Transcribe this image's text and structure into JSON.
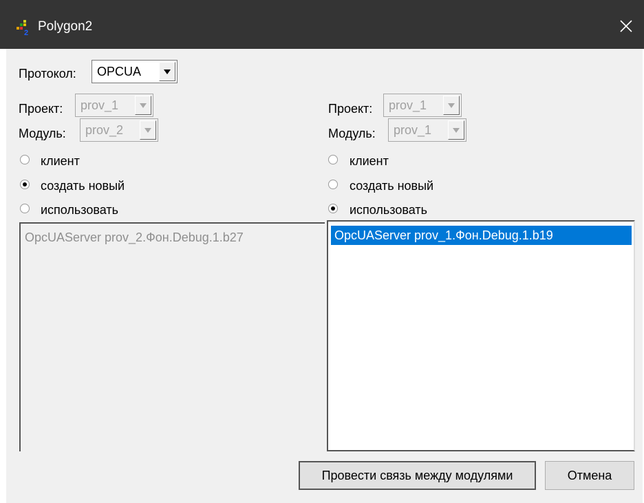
{
  "window": {
    "title": "Polygon2"
  },
  "protocol": {
    "label": "Протокол:",
    "value": "OPCUA"
  },
  "left": {
    "project_label": "Проект:",
    "project_value": "prov_1",
    "module_label": "Модуль:",
    "module_value": "prov_2",
    "radio_client": "клиент",
    "radio_create": "создать новый",
    "radio_use": "использовать",
    "selected_radio": "create",
    "list_items": [
      "OpcUAServer prov_2.Фон.Debug.1.b27"
    ]
  },
  "right": {
    "project_label": "Проект:",
    "project_value": "prov_1",
    "module_label": "Модуль:",
    "module_value": "prov_1",
    "radio_client": "клиент",
    "radio_create": "создать новый",
    "radio_use": "использовать",
    "selected_radio": "use",
    "list_items": [
      "OpcUAServer prov_1.Фон.Debug.1.b19"
    ]
  },
  "buttons": {
    "link_label": "Провести связь между модулями",
    "cancel_label": "Отмена"
  },
  "colors": {
    "titlebar": "#343434",
    "selection": "#0078d7",
    "window_bg": "#f0f0f0"
  }
}
